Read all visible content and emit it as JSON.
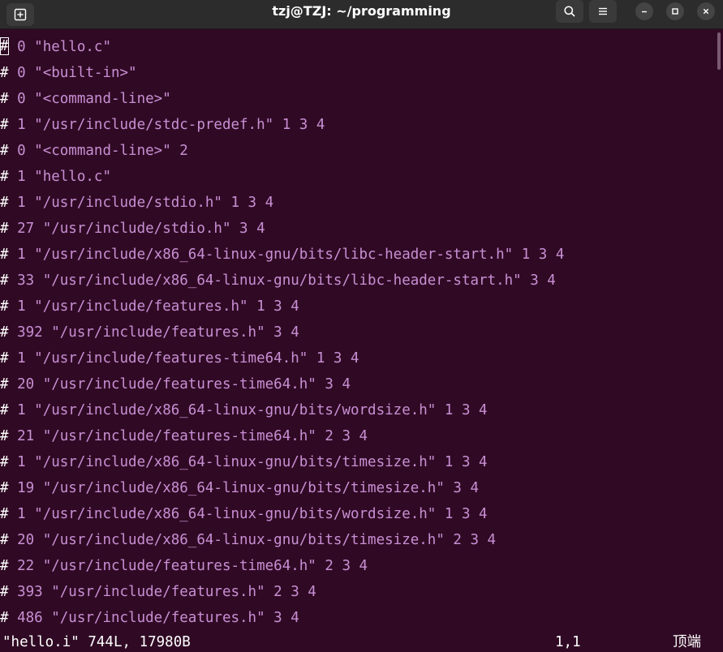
{
  "window": {
    "title": "tzj@TZJ: ~/programming"
  },
  "icons": {
    "new_tab": "new-tab-icon",
    "search": "search-icon",
    "menu": "hamburger-menu-icon",
    "minimize": "minimize-icon",
    "maximize": "maximize-icon",
    "close": "close-icon"
  },
  "colors": {
    "background": "#300a24",
    "text": "#c88fd4",
    "hash": "#ffffff",
    "titlebar": "#2c2c2c"
  },
  "terminal": {
    "lines": [
      {
        "hash": "#",
        "text": " 0 \"hello.c\""
      },
      {
        "hash": "#",
        "text": " 0 \"<built-in>\""
      },
      {
        "hash": "#",
        "text": " 0 \"<command-line>\""
      },
      {
        "hash": "#",
        "text": " 1 \"/usr/include/stdc-predef.h\" 1 3 4"
      },
      {
        "hash": "#",
        "text": " 0 \"<command-line>\" 2"
      },
      {
        "hash": "#",
        "text": " 1 \"hello.c\""
      },
      {
        "hash": "#",
        "text": " 1 \"/usr/include/stdio.h\" 1 3 4"
      },
      {
        "hash": "#",
        "text": " 27 \"/usr/include/stdio.h\" 3 4"
      },
      {
        "hash": "#",
        "text": " 1 \"/usr/include/x86_64-linux-gnu/bits/libc-header-start.h\" 1 3 4"
      },
      {
        "hash": "#",
        "text": " 33 \"/usr/include/x86_64-linux-gnu/bits/libc-header-start.h\" 3 4"
      },
      {
        "hash": "#",
        "text": " 1 \"/usr/include/features.h\" 1 3 4"
      },
      {
        "hash": "#",
        "text": " 392 \"/usr/include/features.h\" 3 4"
      },
      {
        "hash": "#",
        "text": " 1 \"/usr/include/features-time64.h\" 1 3 4"
      },
      {
        "hash": "#",
        "text": " 20 \"/usr/include/features-time64.h\" 3 4"
      },
      {
        "hash": "#",
        "text": " 1 \"/usr/include/x86_64-linux-gnu/bits/wordsize.h\" 1 3 4"
      },
      {
        "hash": "#",
        "text": " 21 \"/usr/include/features-time64.h\" 2 3 4"
      },
      {
        "hash": "#",
        "text": " 1 \"/usr/include/x86_64-linux-gnu/bits/timesize.h\" 1 3 4"
      },
      {
        "hash": "#",
        "text": " 19 \"/usr/include/x86_64-linux-gnu/bits/timesize.h\" 3 4"
      },
      {
        "hash": "#",
        "text": " 1 \"/usr/include/x86_64-linux-gnu/bits/wordsize.h\" 1 3 4"
      },
      {
        "hash": "#",
        "text": " 20 \"/usr/include/x86_64-linux-gnu/bits/timesize.h\" 2 3 4"
      },
      {
        "hash": "#",
        "text": " 22 \"/usr/include/features-time64.h\" 2 3 4"
      },
      {
        "hash": "#",
        "text": " 393 \"/usr/include/features.h\" 2 3 4"
      },
      {
        "hash": "#",
        "text": " 486 \"/usr/include/features.h\" 3 4"
      }
    ]
  },
  "statusline": {
    "file_info": "\"hello.i\" 744L, 17980B",
    "cursor_position": "1,1",
    "scroll_position": "顶端"
  }
}
